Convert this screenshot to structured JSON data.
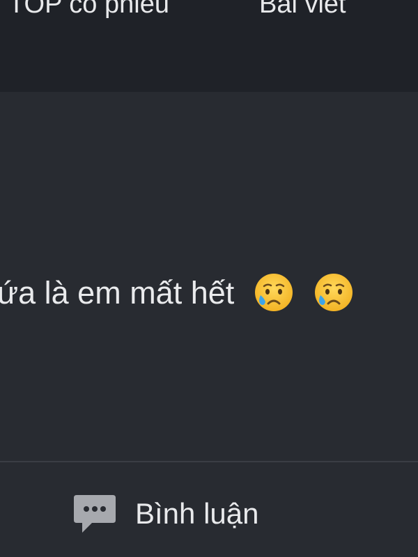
{
  "nav": {
    "tabs": [
      {
        "label": "TOP cổ phiếu"
      },
      {
        "label": "Bài viết"
      }
    ]
  },
  "post": {
    "text": "ứa là em mất hết",
    "emojis": [
      {
        "icon": "sad-but-relieved-face-icon"
      },
      {
        "icon": "sad-but-relieved-face-icon"
      }
    ]
  },
  "actions": {
    "comment_label": "Bình luận",
    "comment_icon": "comment-bubble-icon"
  },
  "colors": {
    "background": "#282b31",
    "header_background": "#1f2228",
    "text": "#e9eaec",
    "icon_gray": "#a7a9ae"
  }
}
